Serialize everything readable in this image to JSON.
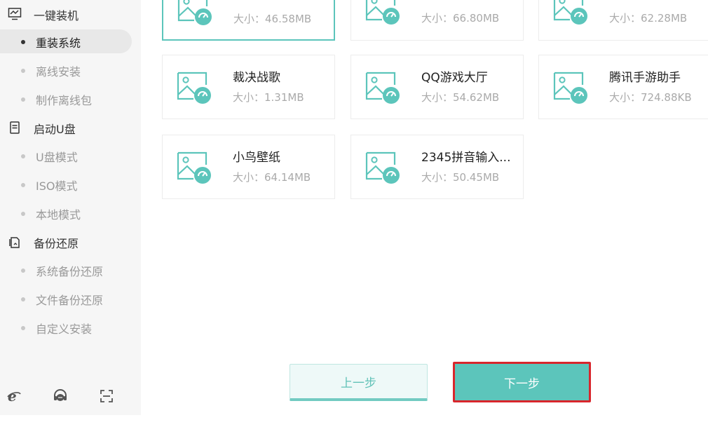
{
  "sidebar": {
    "sections": [
      {
        "label": "一键装机",
        "icon": "monitor-icon",
        "items": [
          {
            "label": "重装系统",
            "active": true
          },
          {
            "label": "离线安装",
            "active": false
          },
          {
            "label": "制作离线包",
            "active": false
          }
        ]
      },
      {
        "label": "启动U盘",
        "icon": "usb-drive-icon",
        "items": [
          {
            "label": "U盘模式",
            "active": false
          },
          {
            "label": "ISO模式",
            "active": false
          },
          {
            "label": "本地模式",
            "active": false
          }
        ]
      },
      {
        "label": "备份还原",
        "icon": "backup-restore-icon",
        "items": [
          {
            "label": "系统备份还原",
            "active": false
          },
          {
            "label": "文件备份还原",
            "active": false
          },
          {
            "label": "自定义安装",
            "active": false
          }
        ]
      }
    ],
    "footer_icons": [
      "ie-browser-icon",
      "customer-service-icon",
      "scan-icon"
    ]
  },
  "software": [
    {
      "name": "",
      "size": "大小：46.58MB",
      "selected": true
    },
    {
      "name": "",
      "size": "大小：66.80MB",
      "selected": false
    },
    {
      "name": "",
      "size": "大小：62.28MB",
      "selected": false
    },
    {
      "name": "裁决战歌",
      "size": "大小：1.31MB",
      "selected": false
    },
    {
      "name": "QQ游戏大厅",
      "size": "大小：54.62MB",
      "selected": false
    },
    {
      "name": "腾讯手游助手",
      "size": "大小：724.88KB",
      "selected": false
    },
    {
      "name": "小鸟壁纸",
      "size": "大小：64.14MB",
      "selected": false
    },
    {
      "name": "2345拼音输入...",
      "size": "大小：50.45MB",
      "selected": false
    }
  ],
  "buttons": {
    "prev_label": "上一步",
    "next_label": "下一步"
  },
  "colors": {
    "accent": "#5cc5bb",
    "highlight_border": "#d9262c",
    "sidebar_bg": "#f6f6f6"
  }
}
